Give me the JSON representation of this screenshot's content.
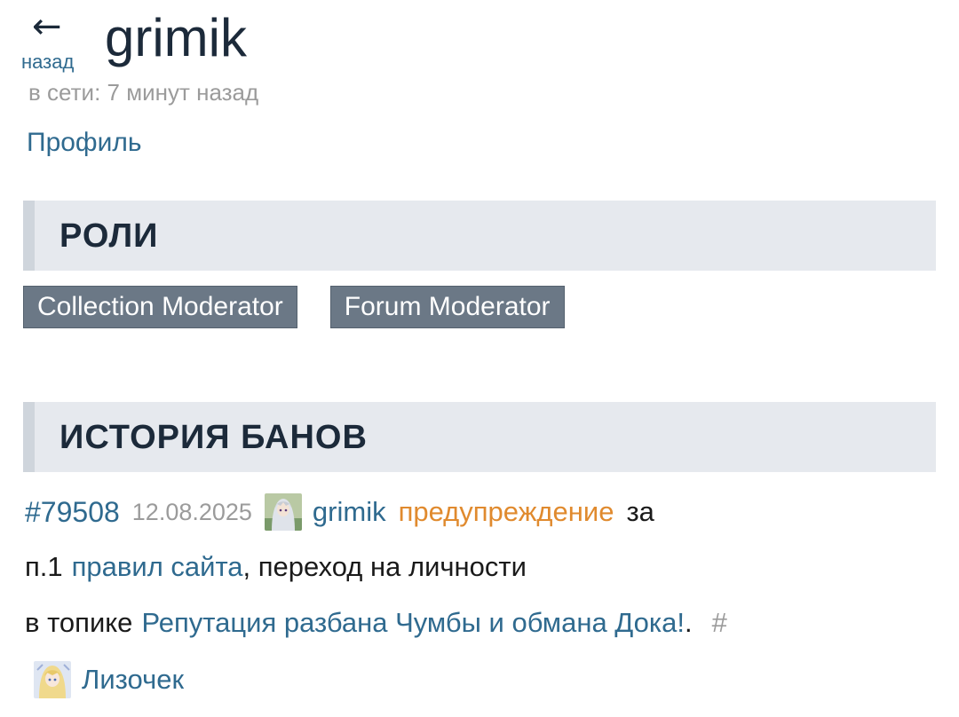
{
  "header": {
    "back_arrow": "←",
    "back_label": "назад",
    "username": "grimik",
    "online_status": "в сети: 7 минут назад",
    "profile_link": "Профиль"
  },
  "roles": {
    "title": "РОЛИ",
    "items": [
      "Collection Moderator",
      "Forum Moderator"
    ]
  },
  "bans": {
    "title": "ИСТОРИЯ БАНОВ",
    "entry": {
      "id": "#79508",
      "date": "12.08.2025",
      "moderator": "grimik",
      "type": "предупреждение",
      "for_word": "за",
      "rule_prefix": "п.1",
      "rules_link": "правил сайта",
      "reason": ", переход на личности",
      "topic_prefix": "в топике",
      "topic_link": "Репутация разбана Чумбы и обмана Дока!",
      "topic_suffix": ".",
      "anchor": "#",
      "target_user": "Лизочек"
    }
  },
  "colors": {
    "link": "#2f6a8f",
    "warning": "#e08a2e",
    "muted": "#9b9b9b",
    "badge_bg": "#6b7886",
    "section_bg": "#e6e9ee"
  }
}
